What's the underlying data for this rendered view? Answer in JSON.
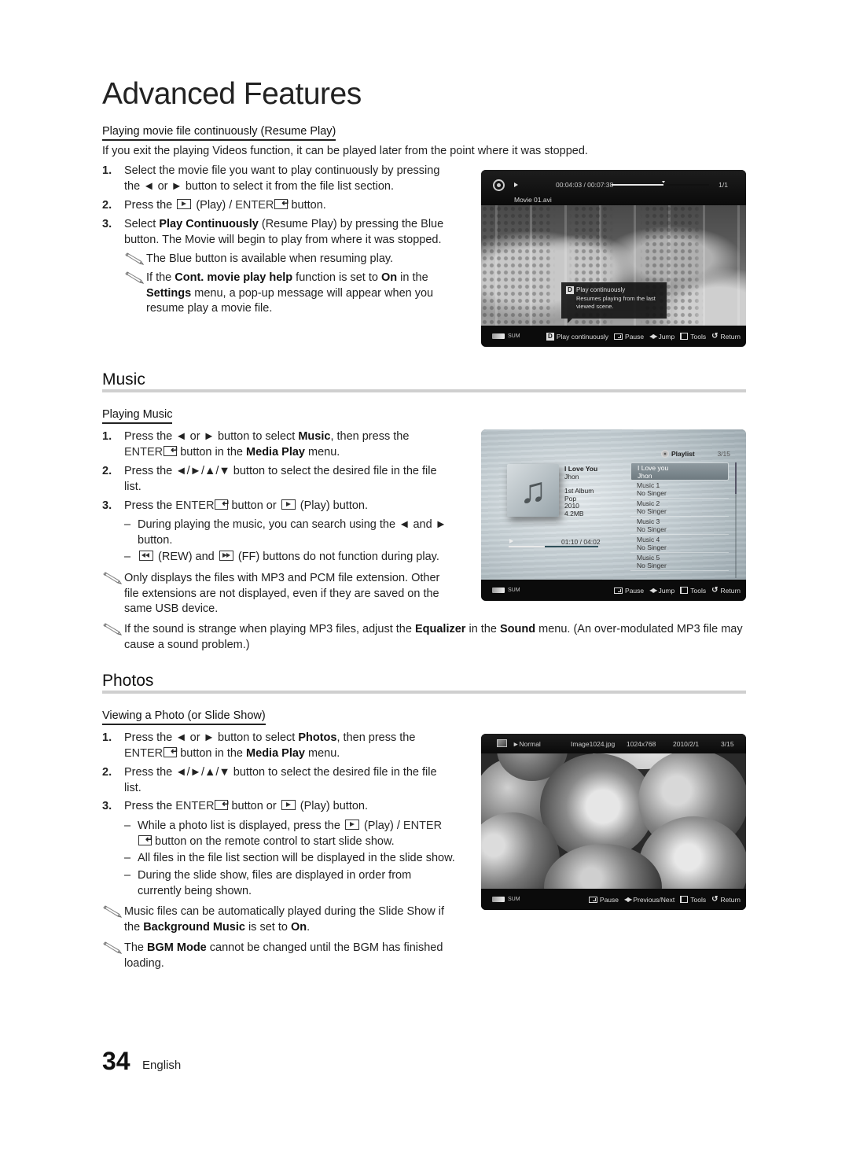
{
  "page": {
    "title": "Advanced Features",
    "page_number": "34",
    "language": "English"
  },
  "resume_play": {
    "heading": "Playing movie file continuously (Resume Play)",
    "intro": "If you exit the playing Videos function, it can be played later from the point where it was stopped.",
    "steps": [
      {
        "num": "1.",
        "parts": [
          "Select the movie file you want to play continuously by pressing the ◄ or ► button to select it from the file list section."
        ]
      },
      {
        "num": "2.",
        "parts": [
          "Press the",
          "(Play) /",
          "ENTER",
          "button."
        ]
      },
      {
        "num": "3.",
        "parts": [
          "Select",
          "Play Continuously",
          "(Resume Play) by pressing the Blue button. The Movie will begin to play from where it was stopped."
        ]
      }
    ],
    "notes": [
      {
        "parts": [
          "The Blue button is available when resuming play."
        ]
      },
      {
        "parts": [
          "If the",
          "Cont. movie play help",
          "function is set to",
          "On",
          "in the",
          "Settings",
          "menu, a pop-up message will appear when you resume play a movie file."
        ]
      }
    ],
    "screen": {
      "time": "00:04:03 / 00:07:38",
      "progress_fraction": 0.53,
      "count": "1/1",
      "filename": "Movie 01.avi",
      "popup_key": "D",
      "popup_title": "Play continuously",
      "popup_desc": "Resumes playing from the last viewed scene.",
      "device": "SUM",
      "hints": [
        {
          "icon": "d-key-icon",
          "label": "Play continuously"
        },
        {
          "icon": "enter-icon",
          "label": "Pause"
        },
        {
          "icon": "left-right-icon",
          "label": "Jump"
        },
        {
          "icon": "tools-icon",
          "label": "Tools"
        },
        {
          "icon": "return-icon",
          "label": "Return"
        }
      ]
    }
  },
  "music": {
    "section_title": "Music",
    "heading": "Playing Music",
    "steps": [
      {
        "num": "1.",
        "parts": [
          "Press the ◄ or ► button to select",
          "Music",
          ", then press the",
          "ENTER",
          "button in the",
          "Media Play",
          "menu."
        ]
      },
      {
        "num": "2.",
        "parts": [
          "Press the ◄/►/▲/▼ button to select the desired file in the file list."
        ]
      },
      {
        "num": "3.",
        "parts": [
          "Press the",
          "ENTER",
          "button or",
          "(Play) button."
        ]
      }
    ],
    "dashes": [
      {
        "parts": [
          "During playing the music, you can search using the ◄ and ► button."
        ]
      },
      {
        "parts": [
          "(REW) and",
          "(FF) buttons do not function during play."
        ]
      }
    ],
    "notes": [
      {
        "parts": [
          "Only displays the files with MP3 and PCM file extension. Other file extensions are not displayed, even if they are saved on the same USB device."
        ]
      },
      {
        "parts": [
          "If the sound is strange when playing MP3 files, adjust the",
          "Equalizer",
          "in the",
          "Sound",
          "menu. (An over-modulated MP3 file may cause a sound problem.)"
        ]
      }
    ],
    "screen": {
      "playlist_label": "Playlist",
      "playlist_count": "3/15",
      "now_playing": {
        "title": "I Love You",
        "artist": "Jhon",
        "album": "1st Album",
        "genre": "Pop",
        "year": "2010",
        "size": "4.2MB"
      },
      "time": "01:10 / 04:02",
      "progress_fraction": 0.4,
      "playlist": [
        {
          "title": "I Love you",
          "artist": "Jhon",
          "active": true
        },
        {
          "title": "Music 1",
          "artist": "No Singer"
        },
        {
          "title": "Music 2",
          "artist": "No Singer"
        },
        {
          "title": "Music 3",
          "artist": "No Singer"
        },
        {
          "title": "Music 4",
          "artist": "No Singer"
        },
        {
          "title": "Music 5",
          "artist": "No Singer"
        }
      ],
      "device": "SUM",
      "hints": [
        {
          "icon": "enter-icon",
          "label": "Pause"
        },
        {
          "icon": "left-right-icon",
          "label": "Jump"
        },
        {
          "icon": "tools-icon",
          "label": "Tools"
        },
        {
          "icon": "return-icon",
          "label": "Return"
        }
      ]
    }
  },
  "photos": {
    "section_title": "Photos",
    "heading": "Viewing a Photo (or Slide Show)",
    "steps": [
      {
        "num": "1.",
        "parts": [
          "Press the ◄ or ► button to select",
          "Photos",
          ", then press the",
          "ENTER",
          "button in the",
          "Media Play",
          "menu."
        ]
      },
      {
        "num": "2.",
        "parts": [
          "Press the ◄/►/▲/▼ button to select the desired file in the file list."
        ]
      },
      {
        "num": "3.",
        "parts": [
          "Press the",
          "ENTER",
          "button or",
          "(Play) button."
        ]
      }
    ],
    "dashes": [
      {
        "parts": [
          "While a photo list is displayed, press the",
          "(Play) /",
          "ENTER",
          "button on the remote control to start slide show."
        ]
      },
      {
        "parts": [
          "All files in the file list section will be displayed in the slide show."
        ]
      },
      {
        "parts": [
          "During the slide show, files are displayed in order from currently being shown."
        ]
      }
    ],
    "notes": [
      {
        "parts": [
          "Music files can be automatically played during the Slide Show if the",
          "Background Music",
          "is set to",
          "On",
          "."
        ]
      },
      {
        "parts": [
          "The",
          "BGM Mode",
          "cannot be changed until the BGM has finished loading."
        ]
      }
    ],
    "screen": {
      "mode": "►Normal",
      "filename": "Image1024.jpg",
      "resolution": "1024x768",
      "date": "2010/2/1",
      "count": "3/15",
      "device": "SUM",
      "hints": [
        {
          "icon": "enter-icon",
          "label": "Pause"
        },
        {
          "icon": "left-right-icon",
          "label": "Previous/Next"
        },
        {
          "icon": "tools-icon",
          "label": "Tools"
        },
        {
          "icon": "return-icon",
          "label": "Return"
        }
      ]
    }
  }
}
